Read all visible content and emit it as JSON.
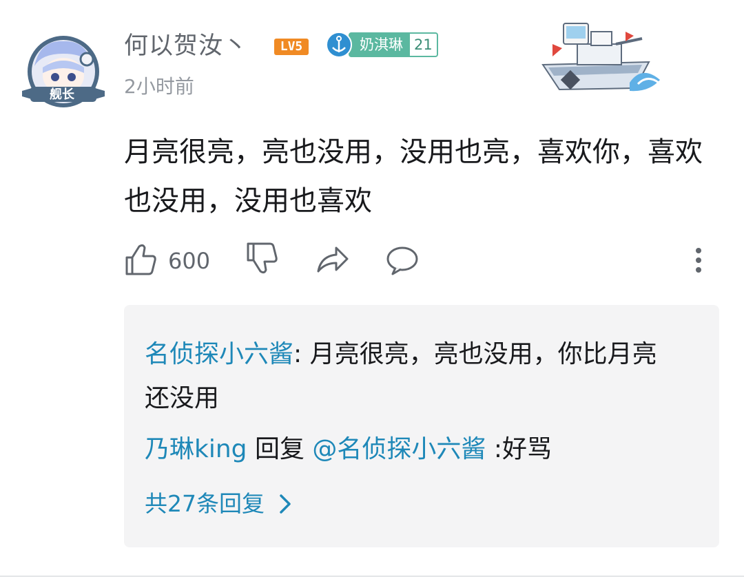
{
  "comment": {
    "username": "何以贺汝丶",
    "level_badge": "LV5",
    "fan_medal": {
      "name": "奶淇琳",
      "level": "21",
      "color": "#5bb8a0"
    },
    "avatar_frame_label": "舰长",
    "time": "2小时前",
    "content": "月亮很亮，亮也没用，没用也亮，喜欢你，喜欢也没用，没用也喜欢",
    "like_count": "600"
  },
  "replies": [
    {
      "author": "名侦探小六酱",
      "separator": ": ",
      "text": "月亮很亮，亮也没用，你比月亮还没用"
    },
    {
      "author": "乃琳king",
      "action": " 回复 ",
      "mention": "@名侦探小六酱",
      "text": " :好骂"
    }
  ],
  "total_replies": "共27条回复",
  "colors": {
    "link": "#1e88b8",
    "level_orange": "#f08a24",
    "reply_bg": "#f4f4f5"
  }
}
